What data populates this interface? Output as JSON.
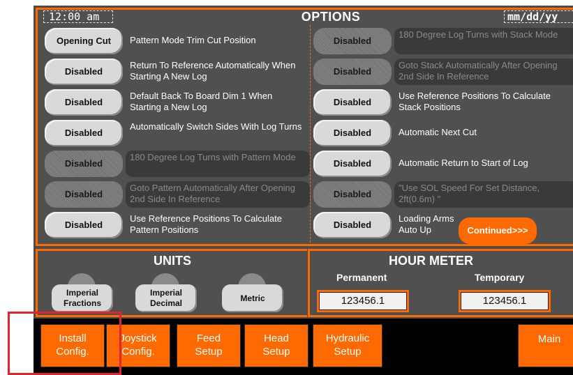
{
  "header": {
    "time": "12:00 am",
    "title": "OPTIONS",
    "date": "mm/dd/yy"
  },
  "options_left": [
    {
      "button": "Opening Cut",
      "text": "Pattern Mode Trim Cut Position",
      "enabled": true
    },
    {
      "button": "Disabled",
      "text": "Return To Reference Automatically When Starting A New Log",
      "enabled": true
    },
    {
      "button": "Disabled",
      "text": "Default Back To Board Dim 1 When Starting a New Log",
      "enabled": true
    },
    {
      "button": "Disabled",
      "text": "Automatically Switch Sides With Log Turns",
      "enabled": true
    },
    {
      "button": "Disabled",
      "text": "180 Degree Log Turns with Pattern Mode",
      "enabled": false
    },
    {
      "button": "Disabled",
      "text": "Goto Pattern Automatically After Opening 2nd Side In Reference",
      "enabled": false
    },
    {
      "button": "Disabled",
      "text": "Use Reference Positions To Calculate Pattern Positions",
      "enabled": true
    }
  ],
  "options_right": [
    {
      "button": "Disabled",
      "text": "180 Degree Log Turns with Stack Mode",
      "enabled": false
    },
    {
      "button": "Disabled",
      "text": "Goto Stack Automatically After Opening 2nd Side In Reference",
      "enabled": false
    },
    {
      "button": "Disabled",
      "text": "Use Reference Positions To Calculate Stack Positions",
      "enabled": true
    },
    {
      "button": "Disabled",
      "text": "Automatic Next Cut",
      "enabled": true
    },
    {
      "button": "Disabled",
      "text": "Automatic Return to Start of Log",
      "enabled": true
    },
    {
      "button": "Disabled",
      "text": "\"Use SOL Speed For Set Distance, 2ft(0.6m) \"",
      "enabled": false
    },
    {
      "button": "Disabled",
      "text": "Loading Arms Auto Up",
      "enabled": true
    }
  ],
  "continued_label": "Continued>>>",
  "units": {
    "title": "UNITS",
    "buttons": [
      {
        "line1": "Imperial",
        "line2": "Fractions"
      },
      {
        "line1": "Imperial",
        "line2": "Decimal"
      },
      {
        "line1": "Metric",
        "line2": ""
      }
    ]
  },
  "hour_meter": {
    "title": "HOUR METER",
    "permanent_label": "Permanent",
    "temporary_label": "Temporary",
    "permanent_value": "123456.1",
    "temporary_value": "123456.1"
  },
  "nav": [
    {
      "line1": "Install",
      "line2": "Config."
    },
    {
      "line1": "Joystick",
      "line2": "Config."
    },
    {
      "line1": "Feed",
      "line2": "Setup"
    },
    {
      "line1": "Head",
      "line2": "Setup"
    },
    {
      "line1": "Hydraulic",
      "line2": "Setup"
    },
    {
      "line1": "Main",
      "line2": ""
    }
  ],
  "colors": {
    "accent": "#ff6a00",
    "panel": "#505050",
    "button": "#d9d9d9",
    "highlight": "#e3232d"
  }
}
